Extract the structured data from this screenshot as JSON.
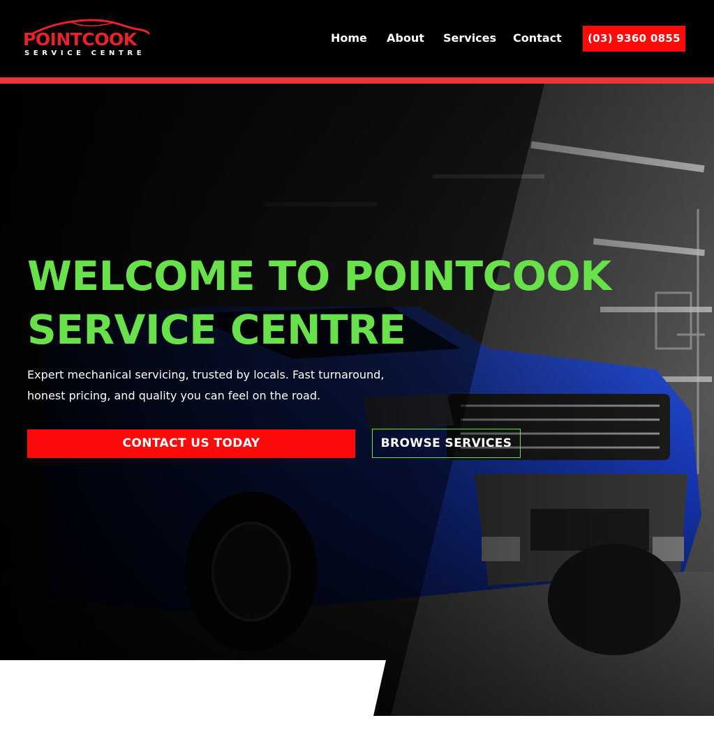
{
  "brand": {
    "name": "POINTCOOK",
    "tagline": "SERVICE CENTRE"
  },
  "nav": {
    "items": [
      {
        "label": "Home"
      },
      {
        "label": "About"
      },
      {
        "label": "Services"
      },
      {
        "label": "Contact"
      }
    ],
    "phone_label": "(03) 9360 0855"
  },
  "hero": {
    "headline_line1": "WELCOME TO POINTCOOK",
    "headline_line2": "SERVICE CENTRE",
    "subtext_line1": "Expert mechanical servicing, trusted by locals. Fast turnaround,",
    "subtext_line2": "honest pricing, and quality you can feel on the road.",
    "primary_cta": "CONTACT US TODAY",
    "secondary_cta": "BROWSE SERVICES"
  },
  "colors": {
    "accent_red": "#ff0a0a",
    "divider_red": "#e8363a",
    "headline_green": "#68e14a",
    "header_bg": "#000000",
    "truck_blue": "#1a3fc4"
  }
}
